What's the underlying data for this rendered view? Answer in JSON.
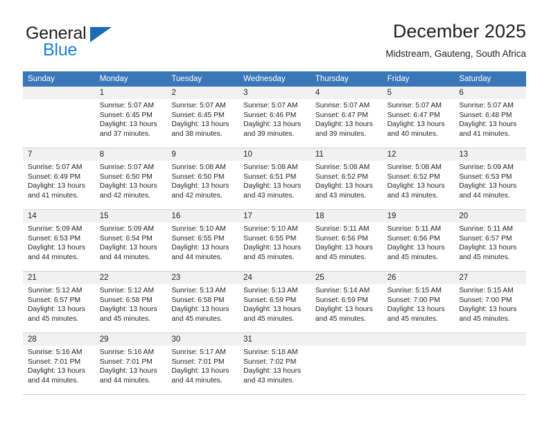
{
  "logo": {
    "word1": "General",
    "word2": "Blue",
    "triangle_icon": "triangle-icon",
    "accent_dark": "#1b6cb3",
    "accent_light": "#1b7fd4"
  },
  "header": {
    "title": "December 2025",
    "subtitle": "Midstream, Gauteng, South Africa"
  },
  "calendar": {
    "header_bg": "#3a77b8",
    "daynum_bg": "#f1f1f1",
    "weekdays": [
      "Sunday",
      "Monday",
      "Tuesday",
      "Wednesday",
      "Thursday",
      "Friday",
      "Saturday"
    ],
    "weeks": [
      [
        {
          "day": "",
          "lines": []
        },
        {
          "day": "1",
          "lines": [
            "Sunrise: 5:07 AM",
            "Sunset: 6:45 PM",
            "Daylight: 13 hours",
            "and 37 minutes."
          ]
        },
        {
          "day": "2",
          "lines": [
            "Sunrise: 5:07 AM",
            "Sunset: 6:45 PM",
            "Daylight: 13 hours",
            "and 38 minutes."
          ]
        },
        {
          "day": "3",
          "lines": [
            "Sunrise: 5:07 AM",
            "Sunset: 6:46 PM",
            "Daylight: 13 hours",
            "and 39 minutes."
          ]
        },
        {
          "day": "4",
          "lines": [
            "Sunrise: 5:07 AM",
            "Sunset: 6:47 PM",
            "Daylight: 13 hours",
            "and 39 minutes."
          ]
        },
        {
          "day": "5",
          "lines": [
            "Sunrise: 5:07 AM",
            "Sunset: 6:47 PM",
            "Daylight: 13 hours",
            "and 40 minutes."
          ]
        },
        {
          "day": "6",
          "lines": [
            "Sunrise: 5:07 AM",
            "Sunset: 6:48 PM",
            "Daylight: 13 hours",
            "and 41 minutes."
          ]
        }
      ],
      [
        {
          "day": "7",
          "lines": [
            "Sunrise: 5:07 AM",
            "Sunset: 6:49 PM",
            "Daylight: 13 hours",
            "and 41 minutes."
          ]
        },
        {
          "day": "8",
          "lines": [
            "Sunrise: 5:07 AM",
            "Sunset: 6:50 PM",
            "Daylight: 13 hours",
            "and 42 minutes."
          ]
        },
        {
          "day": "9",
          "lines": [
            "Sunrise: 5:08 AM",
            "Sunset: 6:50 PM",
            "Daylight: 13 hours",
            "and 42 minutes."
          ]
        },
        {
          "day": "10",
          "lines": [
            "Sunrise: 5:08 AM",
            "Sunset: 6:51 PM",
            "Daylight: 13 hours",
            "and 43 minutes."
          ]
        },
        {
          "day": "11",
          "lines": [
            "Sunrise: 5:08 AM",
            "Sunset: 6:52 PM",
            "Daylight: 13 hours",
            "and 43 minutes."
          ]
        },
        {
          "day": "12",
          "lines": [
            "Sunrise: 5:08 AM",
            "Sunset: 6:52 PM",
            "Daylight: 13 hours",
            "and 43 minutes."
          ]
        },
        {
          "day": "13",
          "lines": [
            "Sunrise: 5:09 AM",
            "Sunset: 6:53 PM",
            "Daylight: 13 hours",
            "and 44 minutes."
          ]
        }
      ],
      [
        {
          "day": "14",
          "lines": [
            "Sunrise: 5:09 AM",
            "Sunset: 6:53 PM",
            "Daylight: 13 hours",
            "and 44 minutes."
          ]
        },
        {
          "day": "15",
          "lines": [
            "Sunrise: 5:09 AM",
            "Sunset: 6:54 PM",
            "Daylight: 13 hours",
            "and 44 minutes."
          ]
        },
        {
          "day": "16",
          "lines": [
            "Sunrise: 5:10 AM",
            "Sunset: 6:55 PM",
            "Daylight: 13 hours",
            "and 44 minutes."
          ]
        },
        {
          "day": "17",
          "lines": [
            "Sunrise: 5:10 AM",
            "Sunset: 6:55 PM",
            "Daylight: 13 hours",
            "and 45 minutes."
          ]
        },
        {
          "day": "18",
          "lines": [
            "Sunrise: 5:11 AM",
            "Sunset: 6:56 PM",
            "Daylight: 13 hours",
            "and 45 minutes."
          ]
        },
        {
          "day": "19",
          "lines": [
            "Sunrise: 5:11 AM",
            "Sunset: 6:56 PM",
            "Daylight: 13 hours",
            "and 45 minutes."
          ]
        },
        {
          "day": "20",
          "lines": [
            "Sunrise: 5:11 AM",
            "Sunset: 6:57 PM",
            "Daylight: 13 hours",
            "and 45 minutes."
          ]
        }
      ],
      [
        {
          "day": "21",
          "lines": [
            "Sunrise: 5:12 AM",
            "Sunset: 6:57 PM",
            "Daylight: 13 hours",
            "and 45 minutes."
          ]
        },
        {
          "day": "22",
          "lines": [
            "Sunrise: 5:12 AM",
            "Sunset: 6:58 PM",
            "Daylight: 13 hours",
            "and 45 minutes."
          ]
        },
        {
          "day": "23",
          "lines": [
            "Sunrise: 5:13 AM",
            "Sunset: 6:58 PM",
            "Daylight: 13 hours",
            "and 45 minutes."
          ]
        },
        {
          "day": "24",
          "lines": [
            "Sunrise: 5:13 AM",
            "Sunset: 6:59 PM",
            "Daylight: 13 hours",
            "and 45 minutes."
          ]
        },
        {
          "day": "25",
          "lines": [
            "Sunrise: 5:14 AM",
            "Sunset: 6:59 PM",
            "Daylight: 13 hours",
            "and 45 minutes."
          ]
        },
        {
          "day": "26",
          "lines": [
            "Sunrise: 5:15 AM",
            "Sunset: 7:00 PM",
            "Daylight: 13 hours",
            "and 45 minutes."
          ]
        },
        {
          "day": "27",
          "lines": [
            "Sunrise: 5:15 AM",
            "Sunset: 7:00 PM",
            "Daylight: 13 hours",
            "and 45 minutes."
          ]
        }
      ],
      [
        {
          "day": "28",
          "lines": [
            "Sunrise: 5:16 AM",
            "Sunset: 7:01 PM",
            "Daylight: 13 hours",
            "and 44 minutes."
          ]
        },
        {
          "day": "29",
          "lines": [
            "Sunrise: 5:16 AM",
            "Sunset: 7:01 PM",
            "Daylight: 13 hours",
            "and 44 minutes."
          ]
        },
        {
          "day": "30",
          "lines": [
            "Sunrise: 5:17 AM",
            "Sunset: 7:01 PM",
            "Daylight: 13 hours",
            "and 44 minutes."
          ]
        },
        {
          "day": "31",
          "lines": [
            "Sunrise: 5:18 AM",
            "Sunset: 7:02 PM",
            "Daylight: 13 hours",
            "and 43 minutes."
          ]
        },
        {
          "day": "",
          "lines": []
        },
        {
          "day": "",
          "lines": []
        },
        {
          "day": "",
          "lines": []
        }
      ]
    ]
  }
}
